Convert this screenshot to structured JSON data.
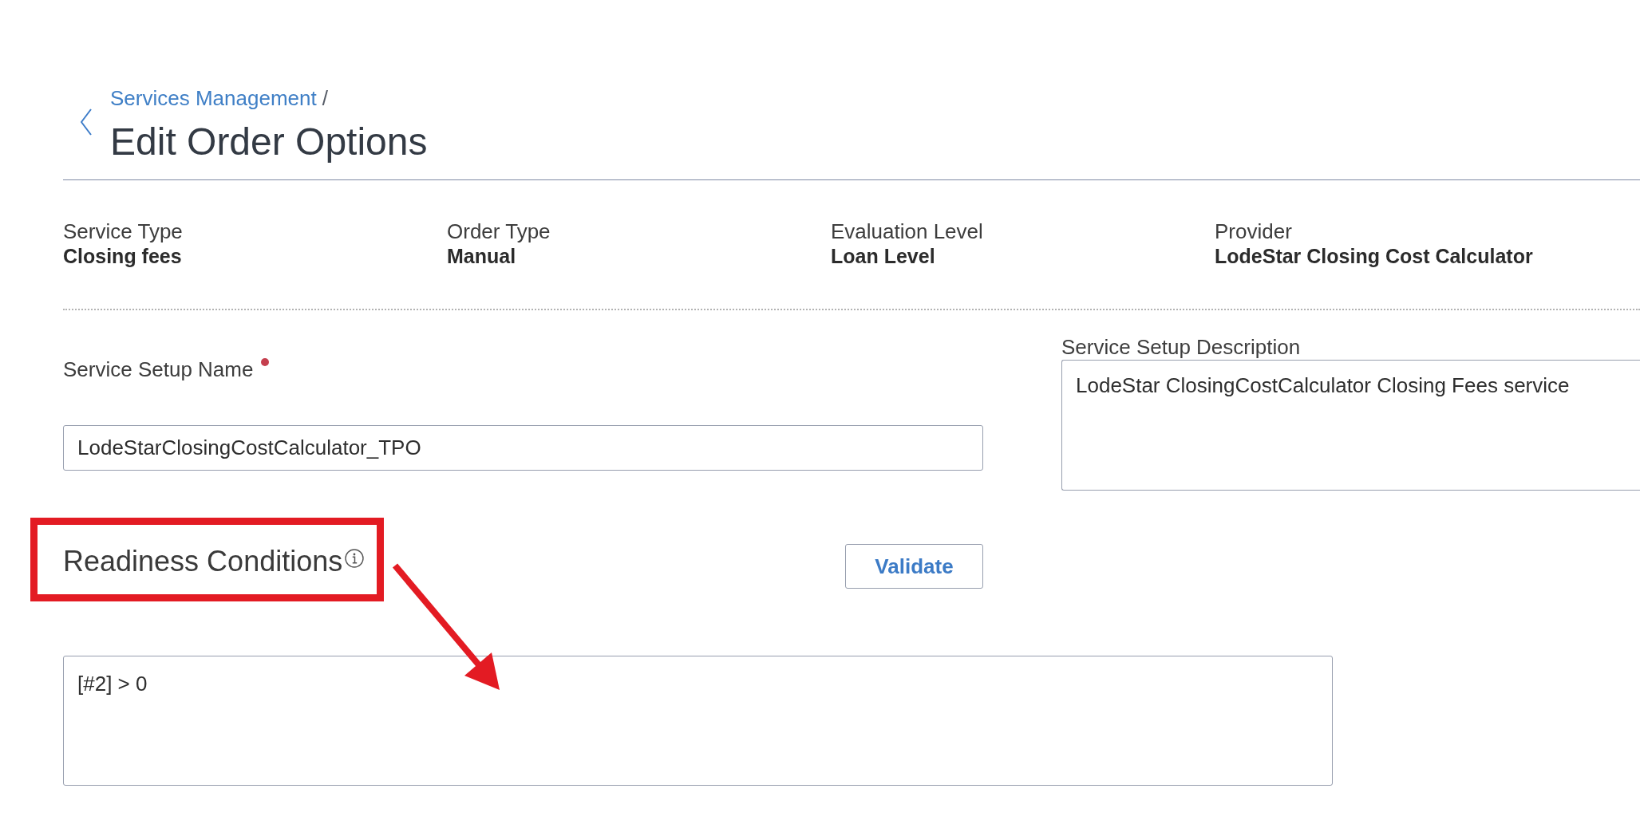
{
  "header": {
    "breadcrumb": {
      "link": "Services Management",
      "separator": "/"
    },
    "title": "Edit Order Options"
  },
  "summary": [
    {
      "label": "Service Type",
      "value": "Closing fees"
    },
    {
      "label": "Order Type",
      "value": "Manual"
    },
    {
      "label": "Evaluation Level",
      "value": "Loan Level"
    },
    {
      "label": "Provider",
      "value": "LodeStar Closing Cost Calculator"
    }
  ],
  "form": {
    "name": {
      "label": "Service Setup Name",
      "required": true,
      "value": "LodeStarClosingCostCalculator_TPO"
    },
    "description": {
      "label": "Service Setup Description",
      "value": "LodeStar ClosingCostCalculator Closing Fees service"
    }
  },
  "readiness": {
    "title": "Readiness Conditions",
    "button": "Validate",
    "expression": "[#2] > 0"
  },
  "annotations": {
    "highlight_box": true,
    "arrow": true
  }
}
